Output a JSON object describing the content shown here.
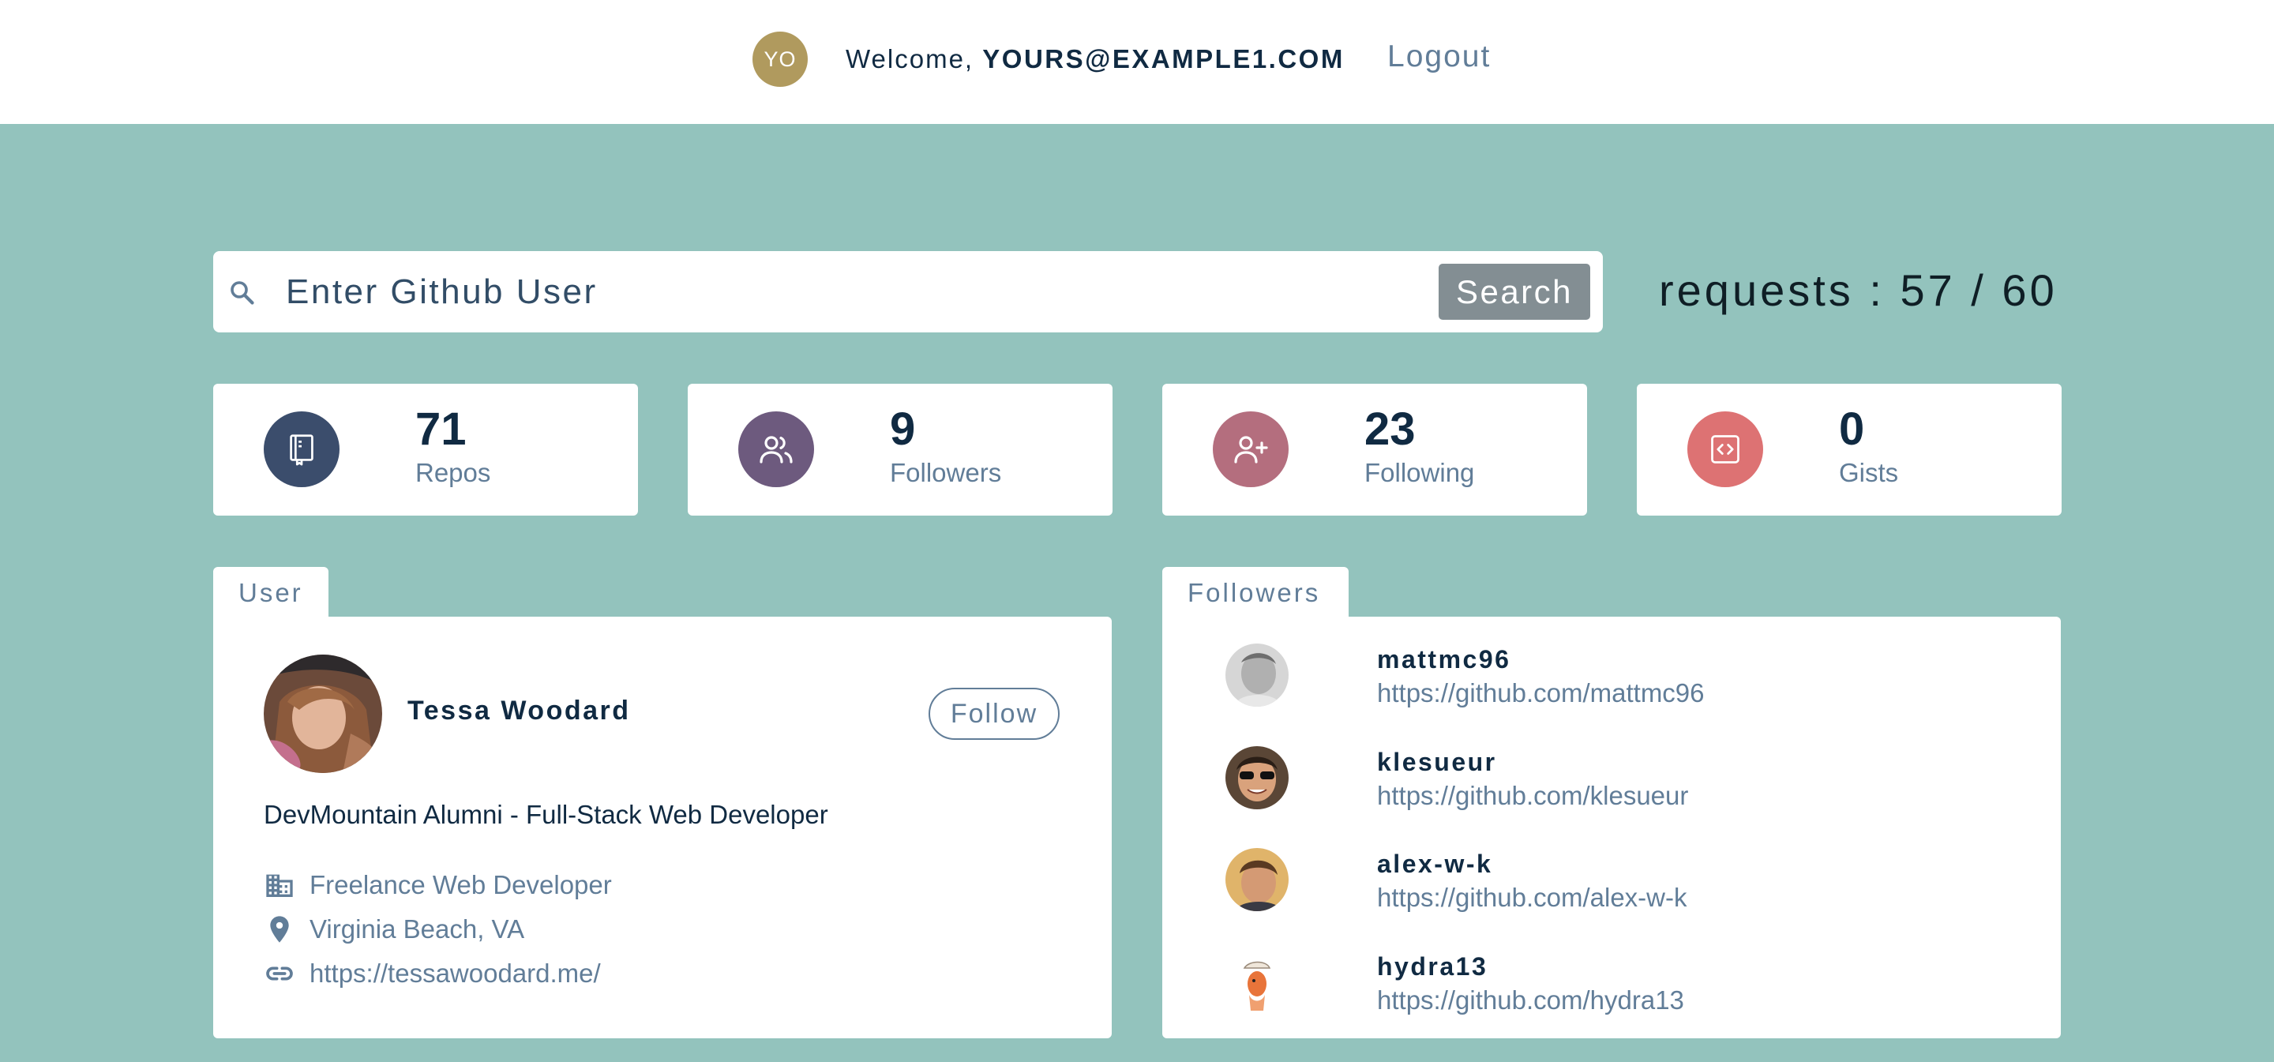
{
  "navbar": {
    "avatar_initials": "YO",
    "welcome_prefix": "Welcome, ",
    "user_email": "YOURS@EXAMPLE1.COM",
    "logout_label": "Logout"
  },
  "search": {
    "placeholder": "Enter Github User",
    "button_label": "Search",
    "requests_text": "requests : 57 / 60"
  },
  "stats": [
    {
      "value": "71",
      "label": "Repos",
      "icon": "book-icon",
      "color": "#3b4d6c"
    },
    {
      "value": "9",
      "label": "Followers",
      "icon": "users-icon",
      "color": "#6d5a7e"
    },
    {
      "value": "23",
      "label": "Following",
      "icon": "user-plus-icon",
      "color": "#b46e7e"
    },
    {
      "value": "0",
      "label": "Gists",
      "icon": "code-icon",
      "color": "#dd7273"
    }
  ],
  "user_panel": {
    "tab_label": "User",
    "name": "Tessa Woodard",
    "follow_label": "Follow",
    "bio": "DevMountain Alumni - Full-Stack Web Developer",
    "company": "Freelance Web Developer",
    "location": "Virginia Beach, VA",
    "blog": "https://tessawoodard.me/"
  },
  "followers_panel": {
    "tab_label": "Followers",
    "items": [
      {
        "login": "mattmc96",
        "url": "https://github.com/mattmc96"
      },
      {
        "login": "klesueur",
        "url": "https://github.com/klesueur"
      },
      {
        "login": "alex-w-k",
        "url": "https://github.com/alex-w-k"
      },
      {
        "login": "hydra13",
        "url": "https://github.com/hydra13"
      }
    ]
  },
  "colors": {
    "page_background": "#93c3bd",
    "primary_text": "#102a42",
    "secondary_text": "#617d98",
    "search_button": "#838e93"
  }
}
